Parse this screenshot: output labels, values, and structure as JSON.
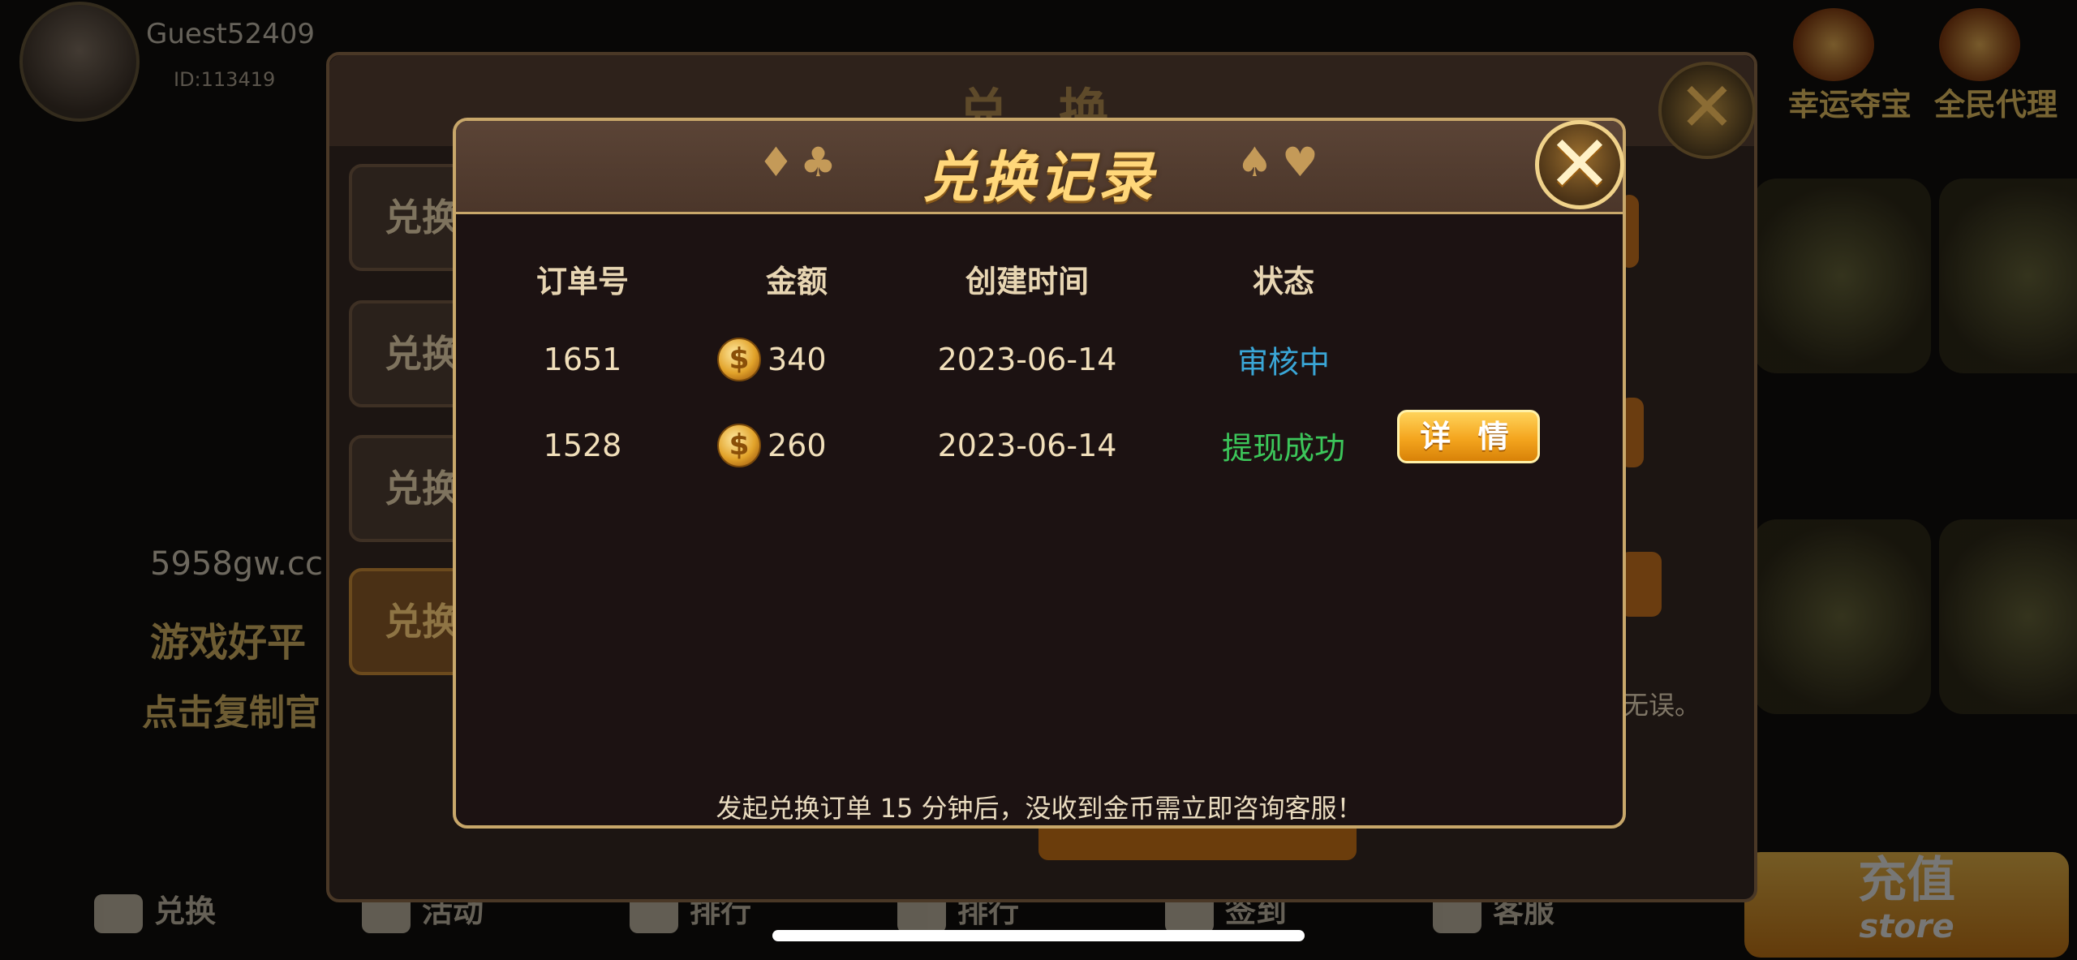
{
  "background": {
    "guest_name": "Guest52409",
    "guest_id": "ID:113419",
    "top_right": [
      "幸运夺宝",
      "全民代理"
    ],
    "bottom_tabs": [
      "兑换",
      "活动",
      "排行",
      "排行",
      "签到",
      "客服"
    ],
    "store": {
      "main": "充值",
      "sub": "store"
    },
    "left_texts": [
      "5958gw.cc",
      "游戏好平",
      "点击复制官"
    ]
  },
  "under_panel": {
    "title": "兑 换",
    "side_buttons": [
      "兑换",
      "兑换",
      "兑换",
      "兑换"
    ],
    "note_tail": "无误。"
  },
  "modal": {
    "title": "兑换记录",
    "suits_left": [
      "♦",
      "♣"
    ],
    "suits_right": [
      "♠",
      "♥"
    ],
    "close_symbol": "✕",
    "columns": [
      "订单号",
      "金额",
      "创建时间",
      "状态"
    ],
    "rows": [
      {
        "order_no": "1651",
        "amount": "340",
        "created": "2023-06-14",
        "status": "审核中"
      },
      {
        "order_no": "1528",
        "amount": "260",
        "created": "2023-06-14",
        "status": "提现成功",
        "action": "详 情"
      }
    ],
    "coin_symbol": "$",
    "footer": "发起兑换订单 15 分钟后，没收到金币需立即咨询客服！"
  },
  "colors": {
    "accent_gold": "#ffd77a",
    "status_pending": "#3aa6d6",
    "status_success": "#3cc65a",
    "border_gold": "#c8a76a"
  }
}
